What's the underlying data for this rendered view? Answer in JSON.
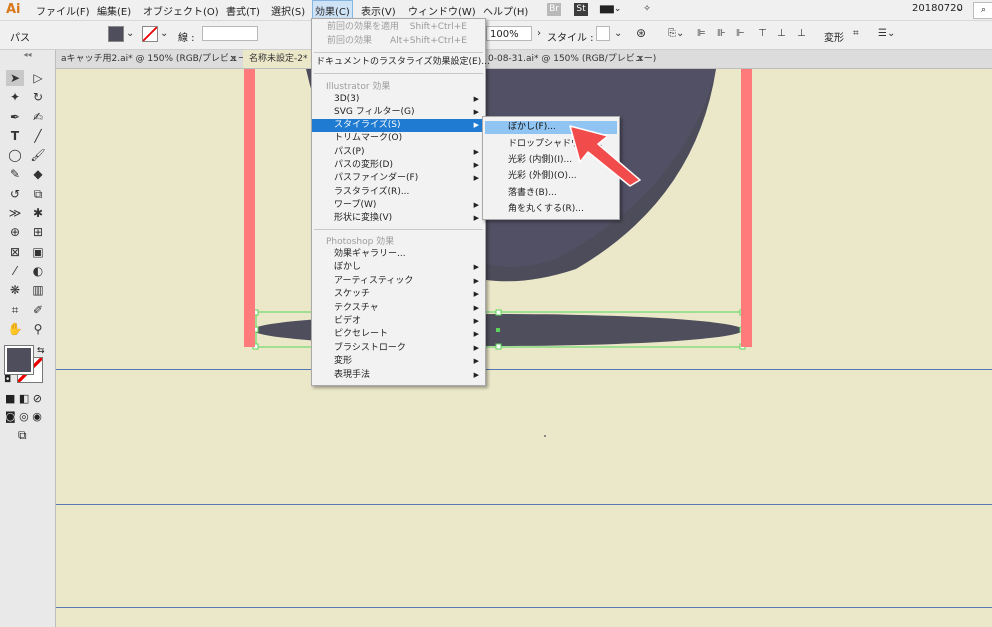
{
  "menubar": {
    "logo": "Ai",
    "items": [
      "ファイル(F)",
      "編集(E)",
      "オブジェクト(O)",
      "書式(T)",
      "選択(S)",
      "効果(C)",
      "表示(V)",
      "ウィンドウ(W)",
      "ヘルプ(H)"
    ],
    "br_label": "Br",
    "st_label": "St",
    "workspace": "20180720",
    "search_icon": "search-icon"
  },
  "controlbar": {
    "object_type": "パス",
    "stroke_label": "線 :",
    "opacity_value": "100%",
    "style_label": "スタイル :",
    "transform_label": "変形",
    "fill_color": "#4f4e5c",
    "stroke_color": "#ff0000"
  },
  "tabs": [
    {
      "label": "aキャッチ用2.ai* @ 150% (RGB/プレビュー)",
      "close": "×"
    },
    {
      "label": "名称未設定-2* @",
      "close": "×"
    },
    {
      "label": "0-08-31.ai* @ 150% (RGB/プレビュー)",
      "close": "×"
    }
  ],
  "effect_menu": {
    "apply_last": {
      "label": "前回の効果を適用",
      "shortcut": "Shift+Ctrl+E"
    },
    "last_effect": {
      "label": "前回の効果",
      "shortcut": "Alt+Shift+Ctrl+E"
    },
    "raster_settings": "ドキュメントのラスタライズ効果設定(E)...",
    "illustrator_header": "Illustrator 効果",
    "illustrator_items": [
      "3D(3)",
      "SVG フィルター(G)",
      "スタイライズ(S)",
      "トリムマーク(O)",
      "パス(P)",
      "パスの変形(D)",
      "パスファインダー(F)",
      "ラスタライズ(R)...",
      "ワープ(W)",
      "形状に変換(V)"
    ],
    "photoshop_header": "Photoshop 効果",
    "photoshop_items": [
      "効果ギャラリー...",
      "ぼかし",
      "アーティスティック",
      "スケッチ",
      "テクスチャ",
      "ビデオ",
      "ピクセレート",
      "ブラシストローク",
      "変形",
      "表現手法"
    ]
  },
  "stylize_submenu": {
    "items": [
      "ぼかし(F)...",
      "ドロップシャドウ(D)...",
      "光彩 (内側)(I)...",
      "光彩 (外側)(O)...",
      "落書き(B)...",
      "角を丸くする(R)..."
    ],
    "highlighted": "ぼかし(F)..."
  },
  "colors": {
    "canvas": "#ebe8c9",
    "menu_highlight": "#1f7bd1",
    "guide": "#5976b5",
    "artboard_bar": "#ff7a7a",
    "shape_fill": "#4f4e5c",
    "arrow": "#f24b4b"
  },
  "tools_icons": [
    "selection-tool-icon",
    "direct-selection-tool-icon",
    "magic-wand-icon",
    "lasso-icon",
    "pen-icon",
    "curvature-icon",
    "type-icon",
    "line-icon",
    "ellipse-icon",
    "paintbrush-icon",
    "shaper-icon",
    "eraser-icon",
    "rotate-icon",
    "scale-icon",
    "width-icon",
    "puppet-warp-icon",
    "shape-builder-icon",
    "perspective-icon",
    "mesh-icon",
    "gradient-icon",
    "eyedropper-icon",
    "blend-icon",
    "symbol-sprayer-icon",
    "graph-icon",
    "artboard-icon",
    "slice-icon",
    "hand-icon",
    "zoom-icon"
  ]
}
